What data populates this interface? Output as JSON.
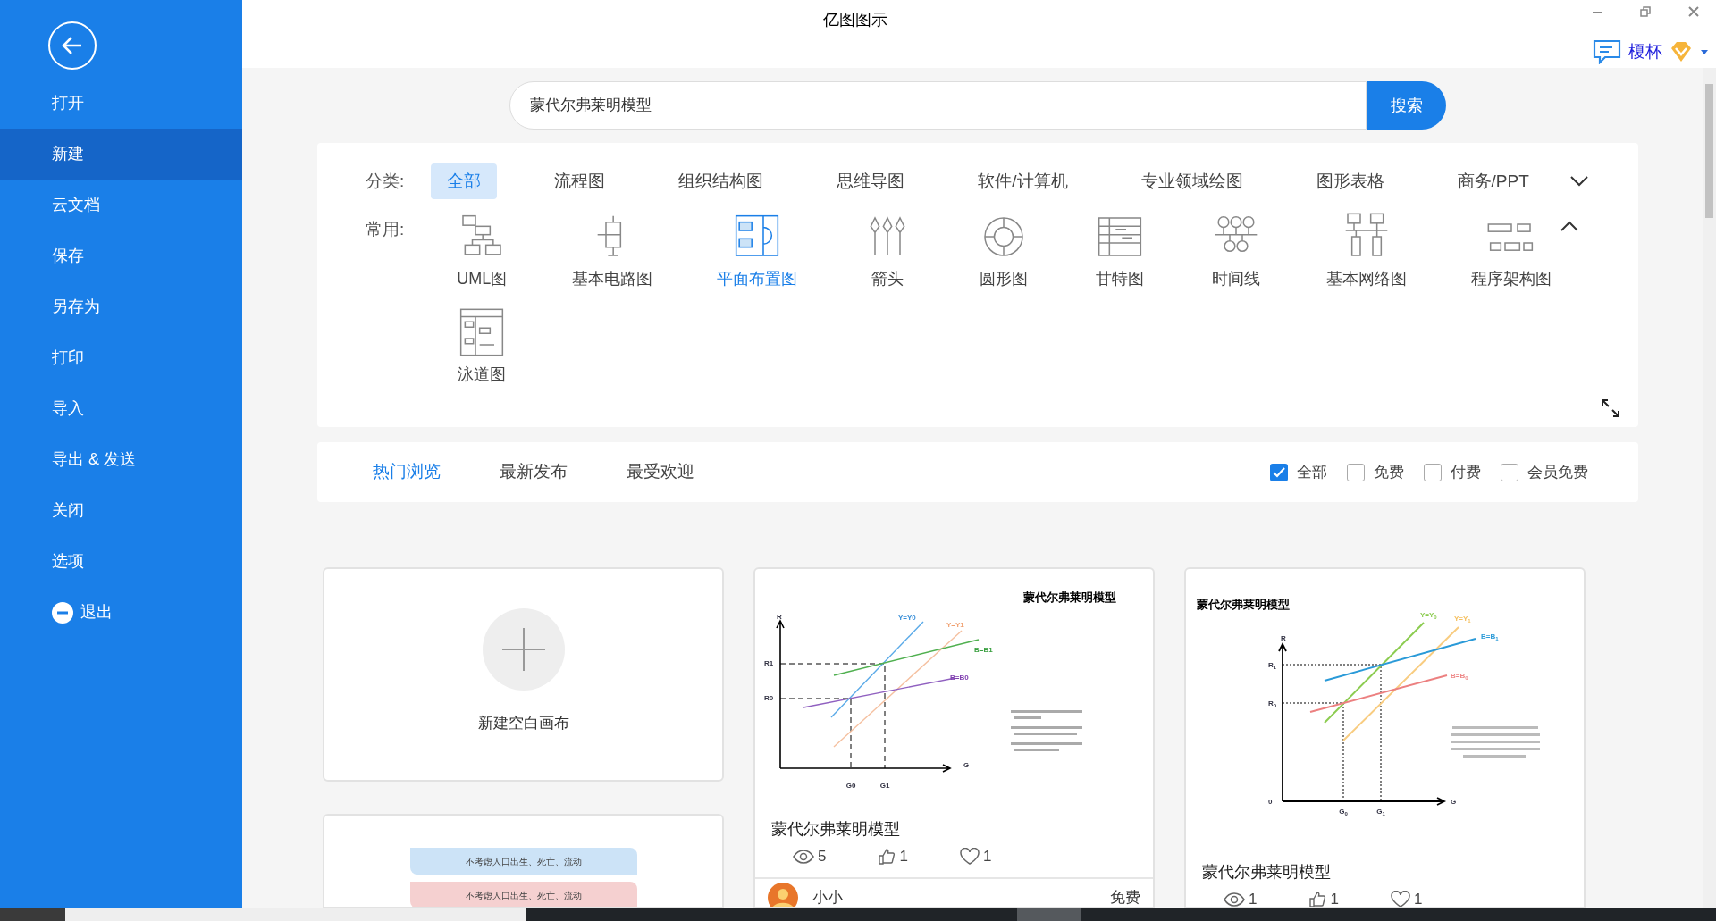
{
  "window": {
    "title": "亿图图示",
    "user": "榎杯"
  },
  "sidebar": {
    "items": [
      {
        "label": "打开",
        "selected": false,
        "kind": "item"
      },
      {
        "label": "新建",
        "selected": true,
        "kind": "item"
      },
      {
        "label": "云文档",
        "selected": false,
        "kind": "item"
      },
      {
        "label": "保存",
        "selected": false,
        "kind": "item"
      },
      {
        "label": "另存为",
        "selected": false,
        "kind": "item"
      },
      {
        "label": "打印",
        "selected": false,
        "kind": "item"
      },
      {
        "label": "导入",
        "selected": false,
        "kind": "item"
      },
      {
        "label": "导出 & 发送",
        "selected": false,
        "kind": "item"
      },
      {
        "label": "关闭",
        "selected": false,
        "kind": "item"
      },
      {
        "label": "选项",
        "selected": false,
        "kind": "item"
      },
      {
        "label": "退出",
        "selected": false,
        "kind": "exit"
      }
    ]
  },
  "search": {
    "value": "蒙代尔弗莱明模型",
    "button": "搜索"
  },
  "categories": {
    "label": "分类:",
    "items": [
      {
        "label": "全部",
        "selected": true
      },
      {
        "label": "流程图",
        "selected": false
      },
      {
        "label": "组织结构图",
        "selected": false
      },
      {
        "label": "思维导图",
        "selected": false
      },
      {
        "label": "软件/计算机",
        "selected": false
      },
      {
        "label": "专业领域绘图",
        "selected": false
      },
      {
        "label": "图形表格",
        "selected": false
      },
      {
        "label": "商务/PPT",
        "selected": false
      }
    ]
  },
  "common": {
    "label": "常用:",
    "items": [
      {
        "label": "UML图",
        "selected": false
      },
      {
        "label": "基本电路图",
        "selected": false
      },
      {
        "label": "平面布置图",
        "selected": true
      },
      {
        "label": "箭头",
        "selected": false
      },
      {
        "label": "圆形图",
        "selected": false
      },
      {
        "label": "甘特图",
        "selected": false
      },
      {
        "label": "时间线",
        "selected": false
      },
      {
        "label": "基本网络图",
        "selected": false
      },
      {
        "label": "程序架构图",
        "selected": false
      },
      {
        "label": "泳道图",
        "selected": false
      }
    ]
  },
  "sort_tabs": [
    {
      "label": "热门浏览",
      "selected": true
    },
    {
      "label": "最新发布",
      "selected": false
    },
    {
      "label": "最受欢迎",
      "selected": false
    }
  ],
  "filters": [
    {
      "label": "全部",
      "checked": true
    },
    {
      "label": "免费",
      "checked": false
    },
    {
      "label": "付费",
      "checked": false
    },
    {
      "label": "会员免费",
      "checked": false
    }
  ],
  "cards": [
    {
      "kind": "new",
      "label": "新建空白画布"
    },
    {
      "kind": "template",
      "thumbnail": {
        "kind": "chart_a",
        "title": "蒙代尔弗莱明模型",
        "labels": [
          {
            "text": "R"
          },
          {
            "text": "R1"
          },
          {
            "text": "R0"
          },
          {
            "text": "G0"
          },
          {
            "text": "G1"
          },
          {
            "text": "G"
          },
          {
            "text": "Y=Y0"
          },
          {
            "text": "Y=Y1"
          },
          {
            "text": "B=B1"
          },
          {
            "text": "B=B0"
          }
        ]
      },
      "title": "蒙代尔弗莱明模型",
      "views": "5",
      "likes": "1",
      "favorites": "1",
      "author": "小小",
      "price": "免费"
    },
    {
      "kind": "template",
      "thumbnail": {
        "kind": "chart_b",
        "title": "蒙代尔弗莱明模型",
        "labels": [
          {
            "text": "R"
          },
          {
            "text": "R",
            "sub": "1"
          },
          {
            "text": "R",
            "sub": "0"
          },
          {
            "text": "G",
            "sub": "0"
          },
          {
            "text": "G",
            "sub": "1"
          },
          {
            "text": "G"
          },
          {
            "text": "Y=Y",
            "sub": "0"
          },
          {
            "text": "Y=Y",
            "sub": "1"
          },
          {
            "text": "B=B",
            "sub": "1"
          },
          {
            "text": "B=B",
            "sub": "0"
          },
          {
            "text": "0"
          }
        ]
      },
      "title": "蒙代尔弗莱明模型",
      "views": "1",
      "likes": "1",
      "favorites": "1"
    },
    {
      "kind": "template",
      "thumbnail": {
        "kind": "flow",
        "boxes": [
          {
            "text": "不考虑人口出生、死亡、流动",
            "color": "#cce3f7"
          },
          {
            "text": "不考虑人口出生、死亡、流动",
            "color": "#f5d0d0"
          }
        ]
      }
    }
  ]
}
